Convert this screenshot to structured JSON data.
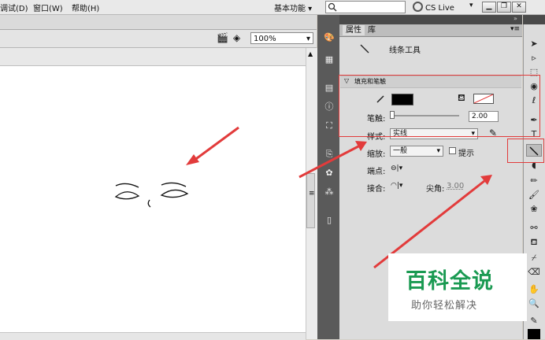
{
  "menu": {
    "items": [
      "调试(D)",
      "窗口(W)",
      "帮助(H)"
    ],
    "workspace_label": "基本功能",
    "cs_live_label": "CS Live"
  },
  "editbar": {
    "zoom": "100%"
  },
  "panel": {
    "tabs": [
      "属性",
      "库"
    ],
    "tool_name": "线条工具",
    "section_fill_stroke": "填充和笔触",
    "stroke_label": "笔触:",
    "stroke_value": "2.00",
    "style_label": "样式:",
    "style_value": "实线",
    "scale_label": "缩放:",
    "scale_value": "一般",
    "hint_label": "提示",
    "cap_label": "端点:",
    "join_label": "接合:",
    "miter_label": "尖角:",
    "miter_value": "3.00"
  },
  "colors": {
    "annotation_red": "#e23b3b",
    "stroke_color": "#000000",
    "watermark_green": "#1a9a52"
  },
  "watermark": {
    "main": "百科全说",
    "sub": "助你轻松解决"
  }
}
